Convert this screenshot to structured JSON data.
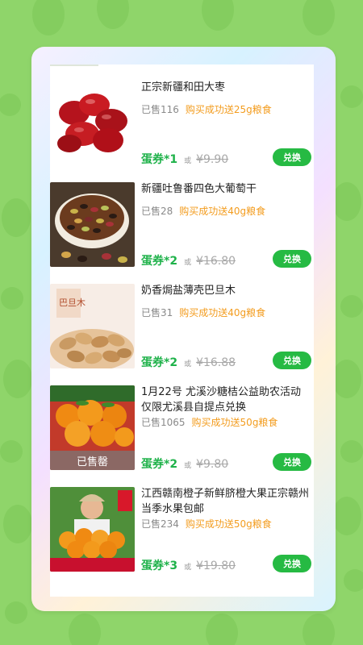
{
  "items": [
    {
      "title": "正宗新疆和田大枣",
      "sold": "已售116",
      "promo": "购买成功送25g粮食",
      "egg": "蛋券*1",
      "or": "或",
      "original": "¥9.90",
      "button": "兑换",
      "image": "red-dates"
    },
    {
      "title": "新疆吐鲁番四色大葡萄干",
      "sold": "已售28",
      "promo": "购买成功送40g粮食",
      "egg": "蛋券*2",
      "or": "或",
      "original": "¥16.80",
      "button": "兑换",
      "image": "raisins"
    },
    {
      "title": "奶香焗盐薄壳巴旦木",
      "sold": "已售31",
      "promo": "购买成功送40g粮食",
      "egg": "蛋券*2",
      "or": "或",
      "original": "¥16.88",
      "button": "兑换",
      "image": "almonds",
      "image_text": "巴旦木"
    },
    {
      "title": "1月22号 尤溪沙糖桔公益助农活动仅限尤溪县自提点兑换",
      "sold": "已售1065",
      "promo": "购买成功送50g粮食",
      "egg": "蛋券*2",
      "or": "或",
      "original": "¥9.80",
      "button": "兑换",
      "image": "tangerines",
      "image_text": "已售罄"
    },
    {
      "title": "江西赣南橙子新鲜脐橙大果正宗赣州当季水果包邮",
      "sold": "已售234",
      "promo": "购买成功送50g粮食",
      "egg": "蛋券*3",
      "or": "或",
      "original": "¥19.80",
      "button": "兑换",
      "image": "oranges"
    }
  ]
}
